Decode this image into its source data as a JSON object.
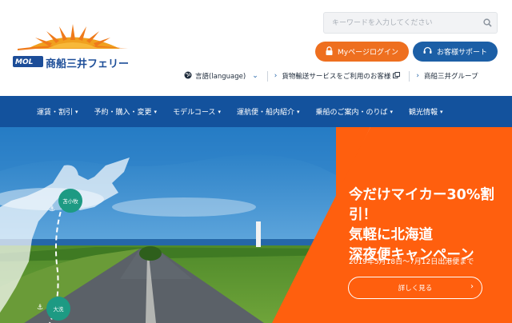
{
  "header": {
    "logo": {
      "brand_mark": "MOL",
      "company_name": "商船三井フェリー"
    },
    "search": {
      "placeholder": "キーワードを入力してください",
      "icon": "search-icon"
    },
    "login_button": {
      "label": "Myページログイン",
      "icon": "lock-icon",
      "color": "#ee6f1f"
    },
    "support_button": {
      "label": "お客様サポート",
      "icon": "headset-icon",
      "color": "#1c5fa6"
    },
    "language": {
      "label": "言語(language)",
      "icon": "globe-icon"
    },
    "links": [
      {
        "label": "貨物輸送サービスをご利用のお客様",
        "icon": "external-link-icon"
      },
      {
        "label": "商船三井グループ"
      }
    ]
  },
  "nav": {
    "background": "#13529d",
    "items": [
      {
        "label": "運賃・割引"
      },
      {
        "label": "予約・購入・変更"
      },
      {
        "label": "モデルコース"
      },
      {
        "label": "運航便・船内紹介"
      },
      {
        "label": "乗船のご案内・のりば"
      },
      {
        "label": "観光情報"
      }
    ]
  },
  "hero": {
    "promo": {
      "background": "#ff5f0e",
      "title_lines": [
        "今だけマイカー30%割引！",
        "気軽に北海道",
        "深夜便キャンペーン"
      ],
      "period": "2019年5月18日～7月12日出港便まで",
      "button_label": "詳しく見る"
    },
    "map": {
      "ports": [
        {
          "label": "苫小牧"
        },
        {
          "label": "大洗"
        }
      ]
    }
  }
}
